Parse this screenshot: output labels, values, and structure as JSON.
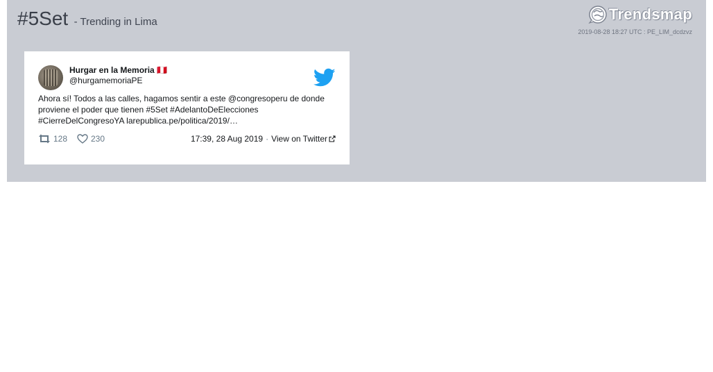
{
  "header": {
    "hashtag": "#5Set",
    "subtitle": "- Trending in Lima",
    "brand": "Trendsmap",
    "timestamp": "2019-08-28 18:27 UTC : PE_LIM_dcdzvz"
  },
  "tweet": {
    "user_name": "Hurgar en la Memoria 🇵🇪",
    "user_handle": "@hurgamemoriaPE",
    "text": "Ahora sí! Todos a las calles, hagamos sentir a este @congresoperu de donde proviene el poder que tienen #5Set #AdelantoDeElecciones #CierreDelCongresoYA larepublica.pe/politica/2019/…",
    "retweets": "128",
    "likes": "230",
    "time": "17:39, 28 Aug 2019",
    "separator": "·",
    "view_link": "View on Twitter"
  },
  "colors": {
    "panel_bg": "#c9ccd3",
    "twitter_blue": "#1da1f2",
    "icon_gray": "#657786"
  },
  "icons": {
    "brand": "trendsmap-globe-icon",
    "source": "twitter-bird-icon",
    "retweet": "retweet-icon",
    "like": "heart-icon",
    "external": "external-link-icon"
  }
}
